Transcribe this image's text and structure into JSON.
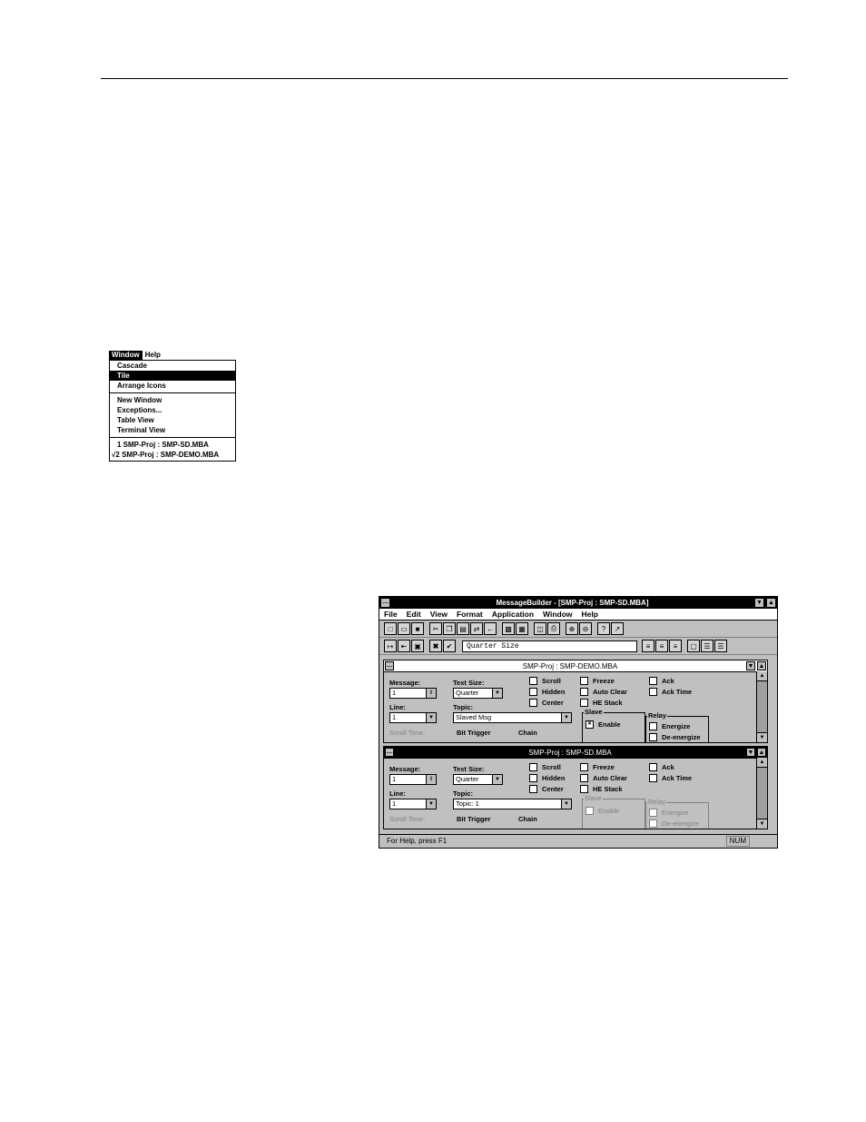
{
  "window_menu": {
    "bar": [
      "Window",
      "Help"
    ],
    "items": [
      "Cascade",
      "Tile",
      "Arrange Icons"
    ],
    "items2": [
      "New Window",
      "Exceptions...",
      "Table View",
      "Terminal View"
    ],
    "docs": [
      "1 SMP-Proj : SMP-SD.MBA",
      "√2 SMP-Proj : SMP-DEMO.MBA"
    ]
  },
  "app": {
    "title": "MessageBuilder - [SMP-Proj : SMP-SD.MBA]",
    "menu": [
      "File",
      "Edit",
      "View",
      "Format",
      "Application",
      "Window",
      "Help"
    ],
    "format_box": "Quarter Size",
    "status_help": "For Help, press F1",
    "status_num": "NUM"
  },
  "child1": {
    "title": "SMP-Proj : SMP-DEMO.MBA",
    "message_label": "Message:",
    "message_value": "1",
    "textsize_label": "Text Size:",
    "textsize_value": "Quarter",
    "line_label": "Line:",
    "line_value": "1",
    "topic_label": "Topic:",
    "topic_value": "Slaved Msg",
    "scroll_time": "Scroll Time:",
    "bit_trigger": "Bit Trigger",
    "chain": "Chain",
    "checks": [
      "Scroll",
      "Hidden",
      "Center",
      "Freeze",
      "Auto Clear",
      "HE Stack",
      "Ack",
      "Ack Time"
    ],
    "slave": "Slave",
    "enable": "Enable",
    "relay": "Relay",
    "energize": "Energize",
    "deenergize": "De-energize"
  },
  "child2": {
    "title": "SMP-Proj : SMP-SD.MBA",
    "message_label": "Message:",
    "message_value": "1",
    "textsize_label": "Text Size:",
    "textsize_value": "Quarter",
    "line_label": "Line:",
    "line_value": "1",
    "topic_label": "Topic:",
    "topic_value": "Topic: 1",
    "scroll_time": "Scroll Time:",
    "bit_trigger": "Bit Trigger",
    "chain": "Chain",
    "checks": [
      "Scroll",
      "Hidden",
      "Center",
      "Freeze",
      "Auto Clear",
      "HE Stack",
      "Ack",
      "Ack Time"
    ],
    "slave": "Slave",
    "enable": "Enable",
    "relay": "Relay",
    "energize": "Energize",
    "deenergize": "De-energize"
  }
}
